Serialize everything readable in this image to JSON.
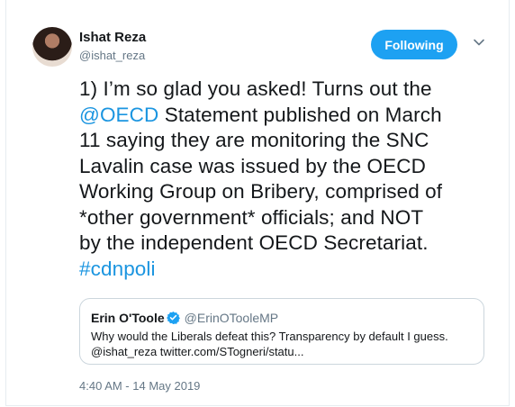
{
  "author": {
    "name": "Ishat Reza",
    "handle": "@ishat_reza"
  },
  "follow_button_label": "Following",
  "tweet": {
    "line1": "1) I’m so glad you asked! Turns out the",
    "mention": "@OECD",
    "line2_rest": " Statement published on March",
    "line3": "11 saying they are monitoring the SNC",
    "line4": "Lavalin case was issued by the OECD",
    "line5": "Working Group on Bribery, comprised of",
    "line6": "*other government* officials; and NOT",
    "line7": "by the independent OECD Secretariat.",
    "hashtag": "#cdnpoli"
  },
  "quoted_tweet": {
    "name": "Erin O'Toole",
    "handle": "@ErinOTooleMP",
    "line1": "Why would the Liberals defeat this? Transparency by default I guess.",
    "line2": "@ishat_reza twitter.com/STogneri/statu..."
  },
  "timestamp": "4:40 AM - 14 May 2019",
  "colors": {
    "accent": "#1da1f2",
    "link": "#1b95e0",
    "secondary_text": "#657786"
  }
}
